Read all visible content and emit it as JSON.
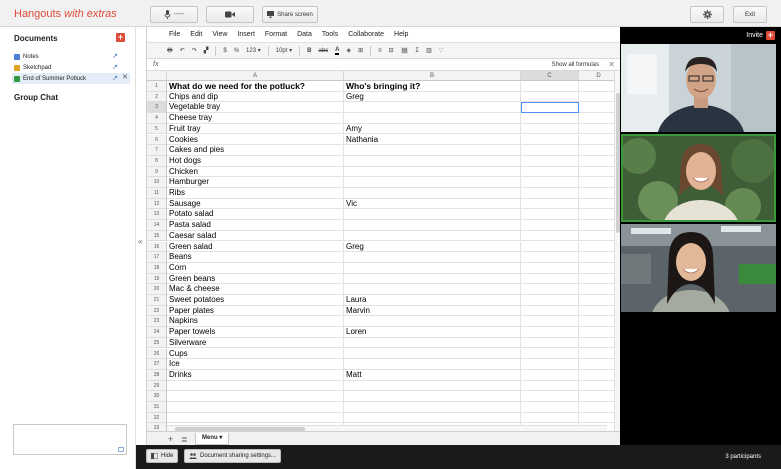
{
  "app": {
    "title_main": "Hangouts ",
    "title_em": "with extras"
  },
  "topbar": {
    "mic_dots": "•••••",
    "share_label": "Share screen",
    "exit_label": "Exit"
  },
  "left": {
    "documents_title": "Documents",
    "docs": [
      {
        "label": "Notes",
        "icon_color": "#4a7fd6"
      },
      {
        "label": "Sketchpad",
        "icon_color": "#e2a21b"
      },
      {
        "label": "End of Summer Potluck",
        "icon_color": "#2f9a3f"
      }
    ],
    "group_chat_title": "Group Chat",
    "collapse_glyph": "«"
  },
  "sheet": {
    "menu": [
      "File",
      "Edit",
      "View",
      "Insert",
      "Format",
      "Data",
      "Tools",
      "Collaborate",
      "Help"
    ],
    "toolbar": {
      "currency": "$",
      "percent": "%",
      "number_format": "123 ▾",
      "font_size": "10pt ▾",
      "bold": "B"
    },
    "fx_label": "fx",
    "show_formulas": "Show all formulas",
    "columns": [
      "A",
      "B",
      "C",
      "D"
    ],
    "rows": [
      [
        "What do we need for the potluck?",
        "Who's bringing it?"
      ],
      [
        "Chips and dip",
        "Greg"
      ],
      [
        "Vegetable tray",
        ""
      ],
      [
        "Cheese tray",
        ""
      ],
      [
        "Fruit tray",
        "Amy"
      ],
      [
        "Cookies",
        "Nathania"
      ],
      [
        "Cakes and pies",
        ""
      ],
      [
        "Hot dogs",
        ""
      ],
      [
        "Chicken",
        ""
      ],
      [
        "Hamburger",
        ""
      ],
      [
        "Ribs",
        ""
      ],
      [
        "Sausage",
        "Vic"
      ],
      [
        "Potato salad",
        ""
      ],
      [
        "Pasta salad",
        ""
      ],
      [
        "Caesar salad",
        ""
      ],
      [
        "Green salad",
        "Greg"
      ],
      [
        "Beans",
        ""
      ],
      [
        "Corn",
        ""
      ],
      [
        "Green beans",
        ""
      ],
      [
        "Mac & cheese",
        ""
      ],
      [
        "Sweet potatoes",
        "Laura"
      ],
      [
        "Paper plates",
        "Marvin"
      ],
      [
        "Napkins",
        ""
      ],
      [
        "Paper towels",
        "Loren"
      ],
      [
        "Silverware",
        ""
      ],
      [
        "Cups",
        ""
      ],
      [
        "Ice",
        ""
      ],
      [
        "Drinks",
        "Matt"
      ],
      [
        "",
        ""
      ],
      [
        "",
        ""
      ],
      [
        "",
        ""
      ],
      [
        "",
        ""
      ],
      [
        "",
        ""
      ]
    ],
    "sheet_menu_label": "Menu ▾"
  },
  "video": {
    "invite_label": "Invite"
  },
  "bottom": {
    "hide_label": "Hide",
    "sharing_label": "Document sharing settings...",
    "participants": "3 participants"
  },
  "colors": {
    "accent_red": "#dd4b39",
    "selection_blue": "#4d90fe",
    "active_speaker": "#3a9a3a"
  }
}
